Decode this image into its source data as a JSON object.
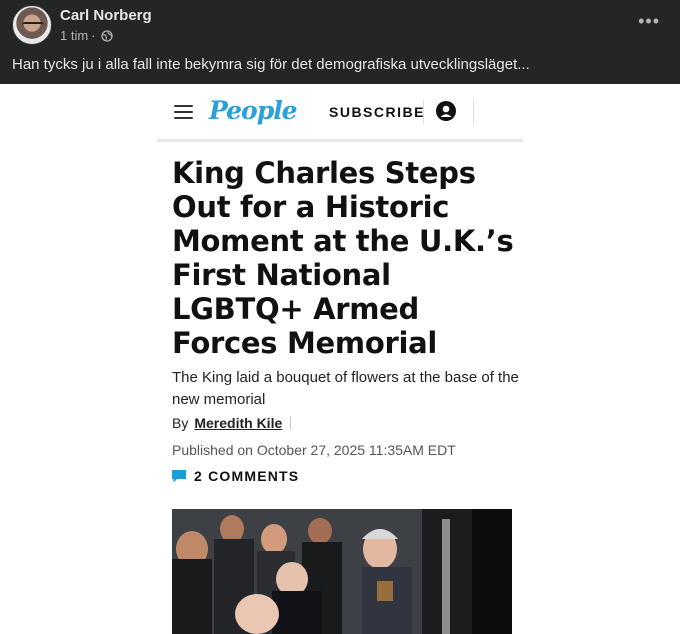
{
  "post": {
    "author": "Carl Norberg",
    "time": "1 tim",
    "separator": "·",
    "text": "Han tycks ju i alla fall inte bekymra sig för det demografiska utvecklingsläget..."
  },
  "article": {
    "brand": "People",
    "subscribe_label": "SUBSCRIBE",
    "headline": "King Charles Steps Out for a Historic Moment at the U.K.’s First National LGBTQ+ Armed Forces Memorial",
    "dek": "The King laid a bouquet of flowers at the base of the new memorial",
    "by_label": "By",
    "author": "Meredith Kile",
    "published": "Published on October 27, 2025 11:35AM EDT",
    "comments_label": "2 COMMENTS"
  },
  "colors": {
    "fb_bg": "#242526",
    "fb_text": "#e4e6eb",
    "fb_secondary": "#b0b3b8",
    "people_blue": "#2a9fd8",
    "comment_blue": "#1aa0d8"
  },
  "icons": [
    "avatar",
    "globe-icon",
    "more-options-icon",
    "menu-icon",
    "user-icon",
    "comment-icon"
  ]
}
